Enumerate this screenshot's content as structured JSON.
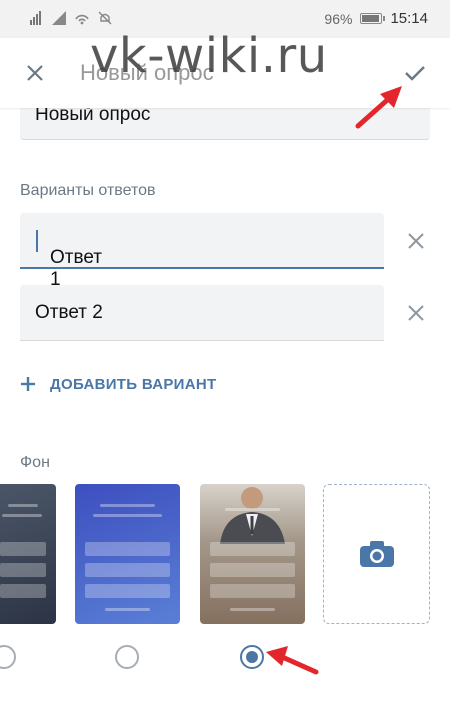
{
  "status_bar": {
    "signal_icons": [
      "sim-signal-icon",
      "signal-icon",
      "wifi-hotspot-icon",
      "muted-icon"
    ],
    "battery_percent": "96%",
    "time": "15:14"
  },
  "header": {
    "title": "Новый опрос",
    "close_icon": "close-icon",
    "confirm_icon": "check-icon"
  },
  "watermark": "vk-wiki.ru",
  "question": {
    "value": "Новый опрос"
  },
  "answers": {
    "label": "Варианты ответов",
    "items": [
      {
        "value": "Ответ 1",
        "active": true
      },
      {
        "value": "Ответ 2",
        "active": false
      }
    ],
    "add_label": "ДОБАВИТЬ ВАРИАНТ"
  },
  "background": {
    "label": "Фон",
    "options": [
      "dark-gradient",
      "blue-gradient",
      "photo",
      "upload-photo"
    ],
    "selected_index": 2
  },
  "colors": {
    "accent": "#4a76a8",
    "annotation_arrow": "#e3262b"
  }
}
